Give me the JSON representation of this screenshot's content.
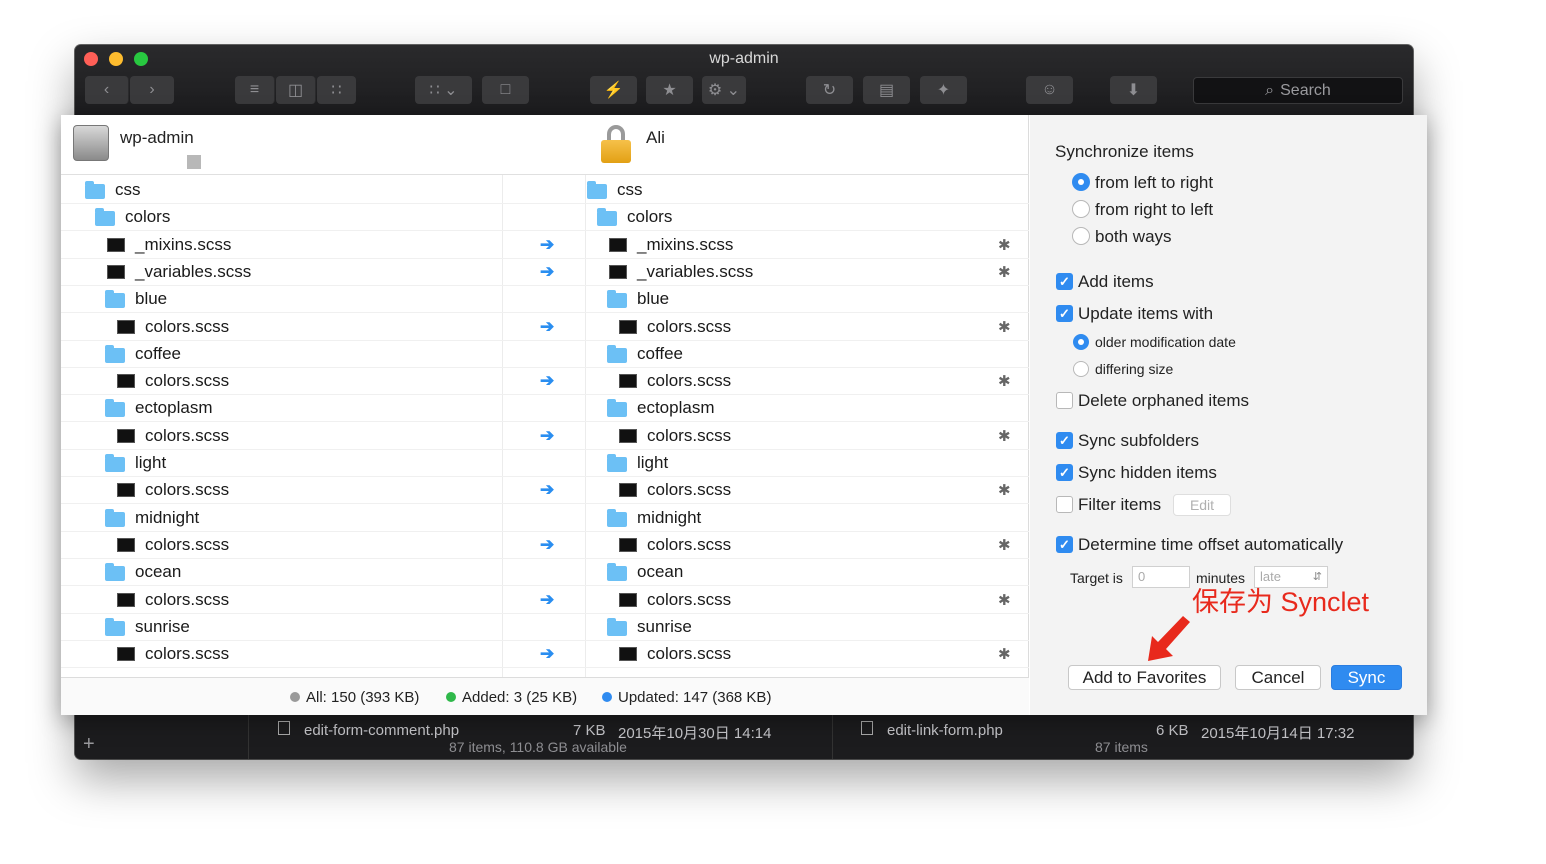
{
  "window": {
    "title": "wp-admin",
    "search_label": "Search"
  },
  "toolbar_icons": [
    "back-icon",
    "forward-icon",
    "list-view-icon",
    "column-view-icon",
    "icon-view-icon",
    "grid-menu-icon",
    "copy-icon",
    "lightning-icon",
    "star-icon",
    "gear-icon",
    "sync-icon",
    "terminal-icon",
    "magic-icon",
    "smile-icon",
    "download-icon"
  ],
  "left_header": {
    "title": "wp-admin"
  },
  "right_header": {
    "title": "Ali"
  },
  "tree": [
    {
      "name": "css",
      "type": "folder",
      "indent": 0,
      "arrow": ""
    },
    {
      "name": "colors",
      "type": "folder",
      "indent": 1,
      "arrow": ""
    },
    {
      "name": "_mixins.scss",
      "type": "file",
      "indent": 2,
      "arrow": "➔"
    },
    {
      "name": "_variables.scss",
      "type": "file",
      "indent": 2,
      "arrow": "➔"
    },
    {
      "name": "blue",
      "type": "folder",
      "indent": 2,
      "arrow": ""
    },
    {
      "name": "colors.scss",
      "type": "file",
      "indent": 3,
      "arrow": "➔"
    },
    {
      "name": "coffee",
      "type": "folder",
      "indent": 2,
      "arrow": ""
    },
    {
      "name": "colors.scss",
      "type": "file",
      "indent": 3,
      "arrow": "➔"
    },
    {
      "name": "ectoplasm",
      "type": "folder",
      "indent": 2,
      "arrow": ""
    },
    {
      "name": "colors.scss",
      "type": "file",
      "indent": 3,
      "arrow": "➔"
    },
    {
      "name": "light",
      "type": "folder",
      "indent": 2,
      "arrow": ""
    },
    {
      "name": "colors.scss",
      "type": "file",
      "indent": 3,
      "arrow": "➔"
    },
    {
      "name": "midnight",
      "type": "folder",
      "indent": 2,
      "arrow": ""
    },
    {
      "name": "colors.scss",
      "type": "file",
      "indent": 3,
      "arrow": "➔"
    },
    {
      "name": "ocean",
      "type": "folder",
      "indent": 2,
      "arrow": ""
    },
    {
      "name": "colors.scss",
      "type": "file",
      "indent": 3,
      "arrow": "➔"
    },
    {
      "name": "sunrise",
      "type": "folder",
      "indent": 2,
      "arrow": ""
    },
    {
      "name": "colors.scss",
      "type": "file",
      "indent": 3,
      "arrow": "➔"
    }
  ],
  "status": {
    "all": "All: 150 (393 KB)",
    "added": "Added: 3 (25 KB)",
    "updated": "Updated: 147 (368 KB)",
    "colors": {
      "all": "#9a9a9a",
      "added": "#2fb84a",
      "updated": "#2f8bf0"
    }
  },
  "options": {
    "sync_title": "Synchronize items",
    "dir_left_right": "from left to right",
    "dir_right_left": "from right to left",
    "dir_both": "both ways",
    "add_items": "Add items",
    "update_items": "Update items with",
    "older_date": "older modification date",
    "differing_size": "differing size",
    "delete_orphaned": "Delete orphaned items",
    "sync_subfolders": "Sync subfolders",
    "sync_hidden": "Sync hidden items",
    "filter_items": "Filter items",
    "edit": "Edit",
    "time_offset": "Determine time offset automatically",
    "target_is": "Target is",
    "minutes_value": "0",
    "minutes": "minutes",
    "late": "late"
  },
  "annotation": "保存为 Synclet",
  "buttons": {
    "favorites": "Add to Favorites",
    "cancel": "Cancel",
    "sync": "Sync"
  },
  "bottom": {
    "left_file": "edit-form-comment.php",
    "left_size": "7 KB",
    "left_date": "2015年10月30日 14:14",
    "left_info": "87 items, 110.8 GB available",
    "right_file": "edit-link-form.php",
    "right_size": "6 KB",
    "right_date": "2015年10月14日 17:32",
    "right_info": "87 items"
  },
  "accent_color": "#2f8bf0"
}
